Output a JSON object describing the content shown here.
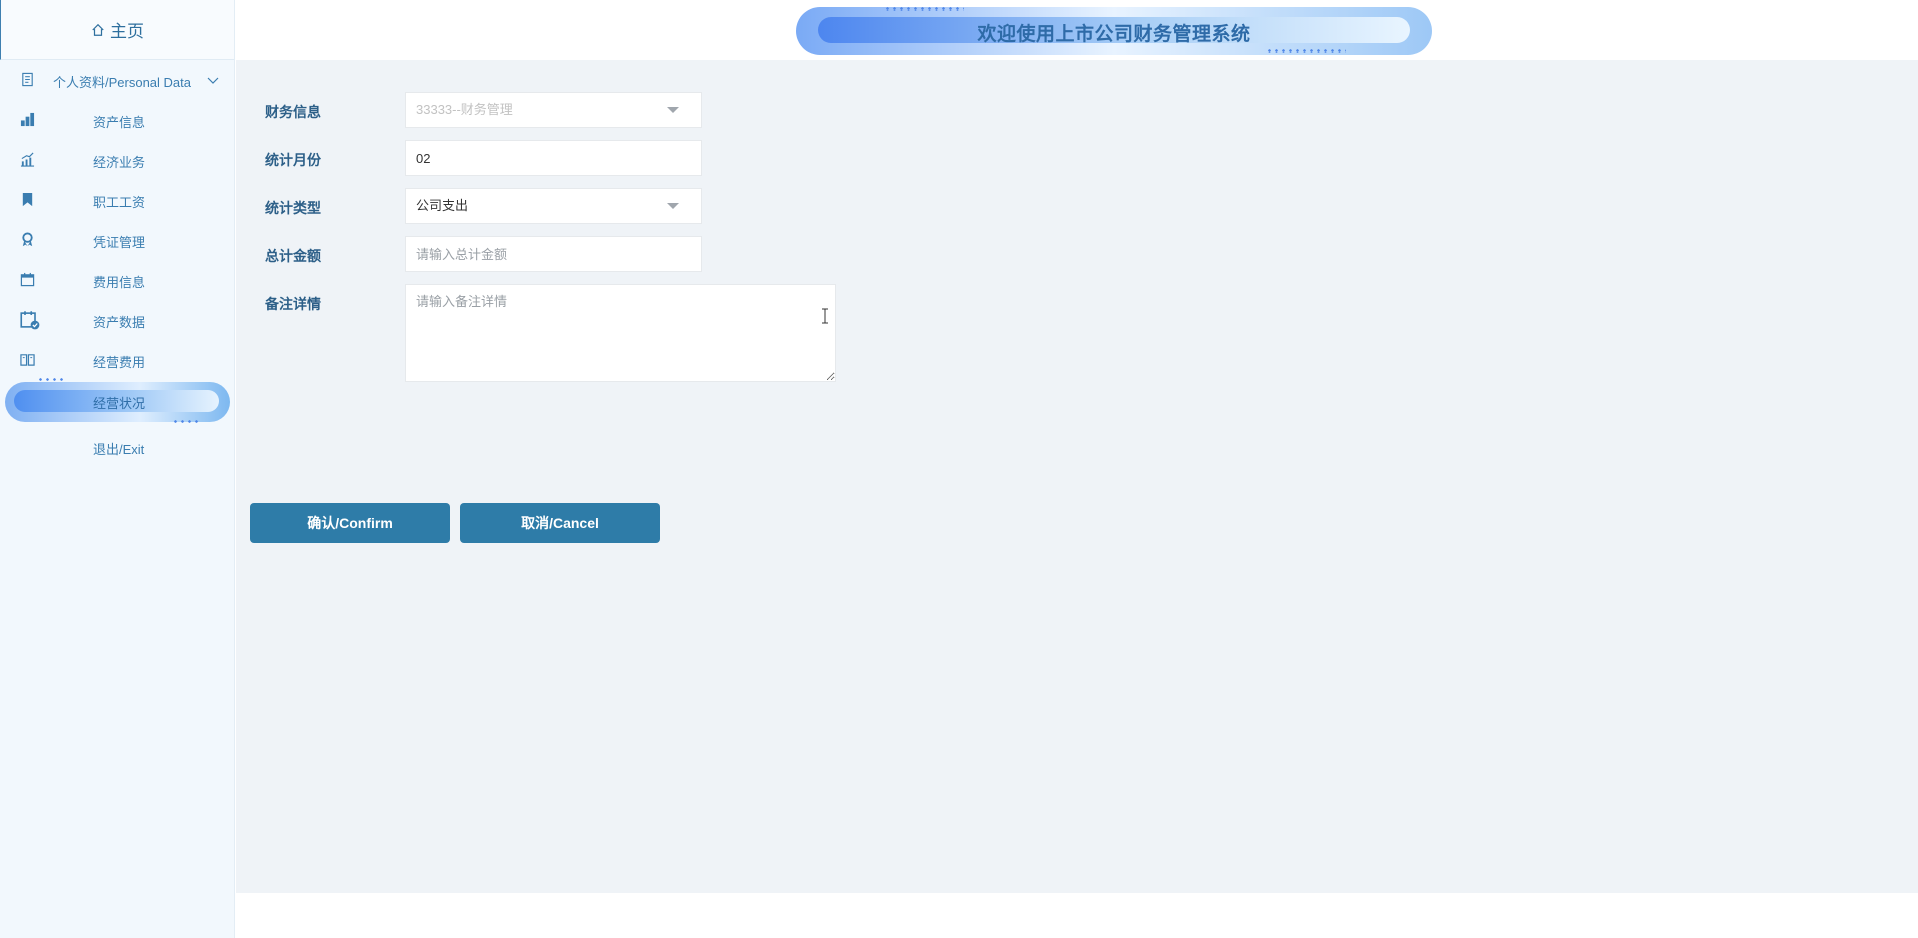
{
  "sidebar": {
    "home_label": "主页",
    "items": [
      {
        "label": "个人资料/Personal Data",
        "icon": "personal-data-icon"
      },
      {
        "label": "资产信息",
        "icon": "asset-info-icon"
      },
      {
        "label": "经济业务",
        "icon": "chart-icon"
      },
      {
        "label": "职工工资",
        "icon": "bookmark-icon"
      },
      {
        "label": "凭证管理",
        "icon": "award-icon"
      },
      {
        "label": "费用信息",
        "icon": "calendar-icon"
      },
      {
        "label": "资产数据",
        "icon": "calendar-check-icon"
      },
      {
        "label": "经营费用",
        "icon": "book-icon"
      },
      {
        "label": "经营状况",
        "icon": "",
        "active": true
      },
      {
        "label": "退出/Exit",
        "icon": ""
      }
    ]
  },
  "header": {
    "title": "欢迎使用上市公司财务管理系统"
  },
  "form": {
    "finance_info": {
      "label": "财务信息",
      "value": "33333--财务管理"
    },
    "stat_month": {
      "label": "统计月份",
      "value": "02"
    },
    "stat_type": {
      "label": "统计类型",
      "value": "公司支出"
    },
    "total_amount": {
      "label": "总计金额",
      "placeholder": "请输入总计金额"
    },
    "remarks": {
      "label": "备注详情",
      "placeholder": "请输入备注详情"
    }
  },
  "buttons": {
    "confirm": "确认/Confirm",
    "cancel": "取消/Cancel"
  },
  "colors": {
    "primary": "#2e7ca8",
    "label": "#2c5f88",
    "sidebar_bg": "#f2f8fd",
    "main_bg": "#eff3f7"
  }
}
